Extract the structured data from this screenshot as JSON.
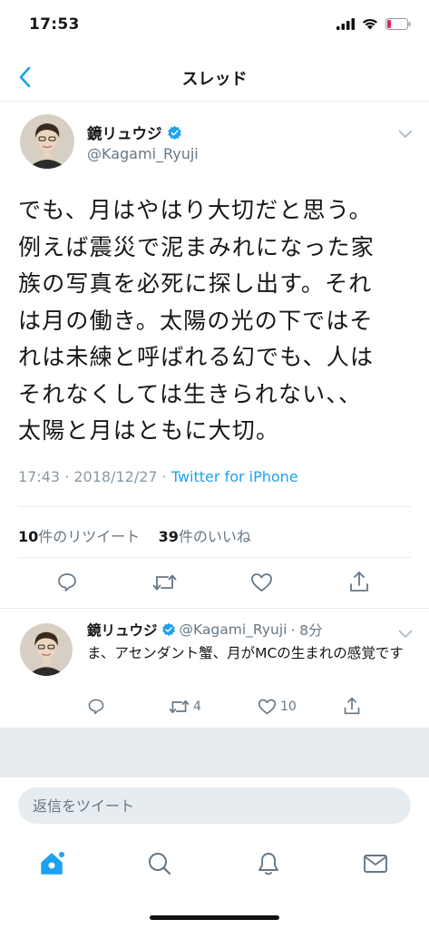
{
  "status_bar": {
    "time": "17:53"
  },
  "nav": {
    "title": "スレッド"
  },
  "main_tweet": {
    "author_name": "鏡リュウジ",
    "handle": "@Kagami_Ryuji",
    "text_lines": [
      "でも、月はやはり大切だと思う。",
      "例えば震災で泥まみれになった家",
      "族の写真を必死に探し出す。それ",
      "は月の働き。太陽の光の下ではそ",
      "れは未練と呼ばれる幻でも、人は",
      "それなくしては生きられない、、",
      "太陽と月はともに大切。"
    ],
    "timestamp": "17:43 · 2018/12/27 · ",
    "source": "Twitter for iPhone",
    "retweet_count": "10",
    "retweet_label": "件のリツイート",
    "like_count": "39",
    "like_label": "件のいいね"
  },
  "reply_tweet": {
    "author_name": "鏡リュウジ",
    "handle": "@Kagami_Ryuji",
    "time": "· 8分",
    "text": "ま、アセンダント蟹、月がMCの生まれの感覚です",
    "retweets": "4",
    "likes": "10"
  },
  "reply_bar": {
    "placeholder": "返信をツイート"
  },
  "colors": {
    "accent": "#1da1f2",
    "muted": "#657786",
    "divider": "#e6ecf0"
  },
  "icons": [
    "reply-icon",
    "retweet-icon",
    "like-icon",
    "share-icon",
    "home-icon",
    "search-icon",
    "notifications-icon",
    "messages-icon",
    "verified-badge-icon"
  ]
}
